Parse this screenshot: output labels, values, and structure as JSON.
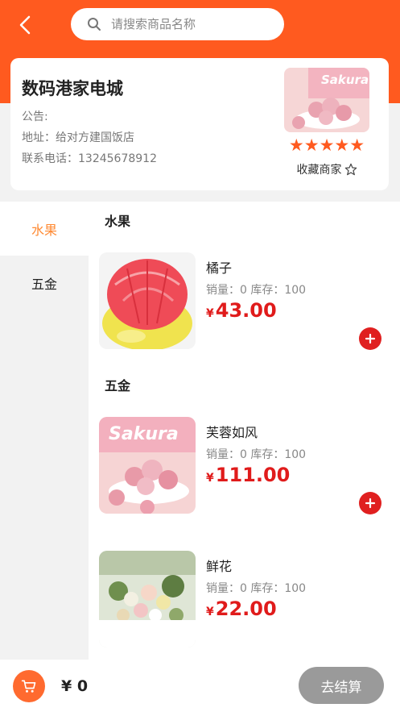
{
  "header": {
    "search_placeholder": "请搜索商品名称"
  },
  "shop": {
    "name": "数码港家电城",
    "notice_label": "公告:",
    "address": "地址：给对方建国饭店",
    "phone": "联系电话：13245678912",
    "rating_stars": "★★★★★",
    "favorite_label": "收藏商家"
  },
  "categories": [
    {
      "label": "水果"
    },
    {
      "label": "五金"
    }
  ],
  "sections": [
    {
      "title": "水果",
      "products": [
        {
          "name": "橘子",
          "stats": "销量：0   库存：100",
          "currency": "¥",
          "price": "43.00",
          "image": "pomelo"
        }
      ]
    },
    {
      "title": "五金",
      "products": [
        {
          "name": "芙蓉如风",
          "stats": "销量：0   库存：100",
          "currency": "¥",
          "price": "111.00",
          "image": "sakura-candy"
        },
        {
          "name": "鲜花",
          "stats": "销量：0   库存：100",
          "currency": "¥",
          "price": "22.00",
          "image": "flowers"
        }
      ]
    }
  ],
  "bottom": {
    "total": "¥ 0",
    "checkout_label": "去结算"
  },
  "colors": {
    "brand": "#ff5a1f",
    "price": "#e01b1b",
    "active_category": "#ff8a33",
    "checkout_disabled": "#9a9a9a"
  }
}
